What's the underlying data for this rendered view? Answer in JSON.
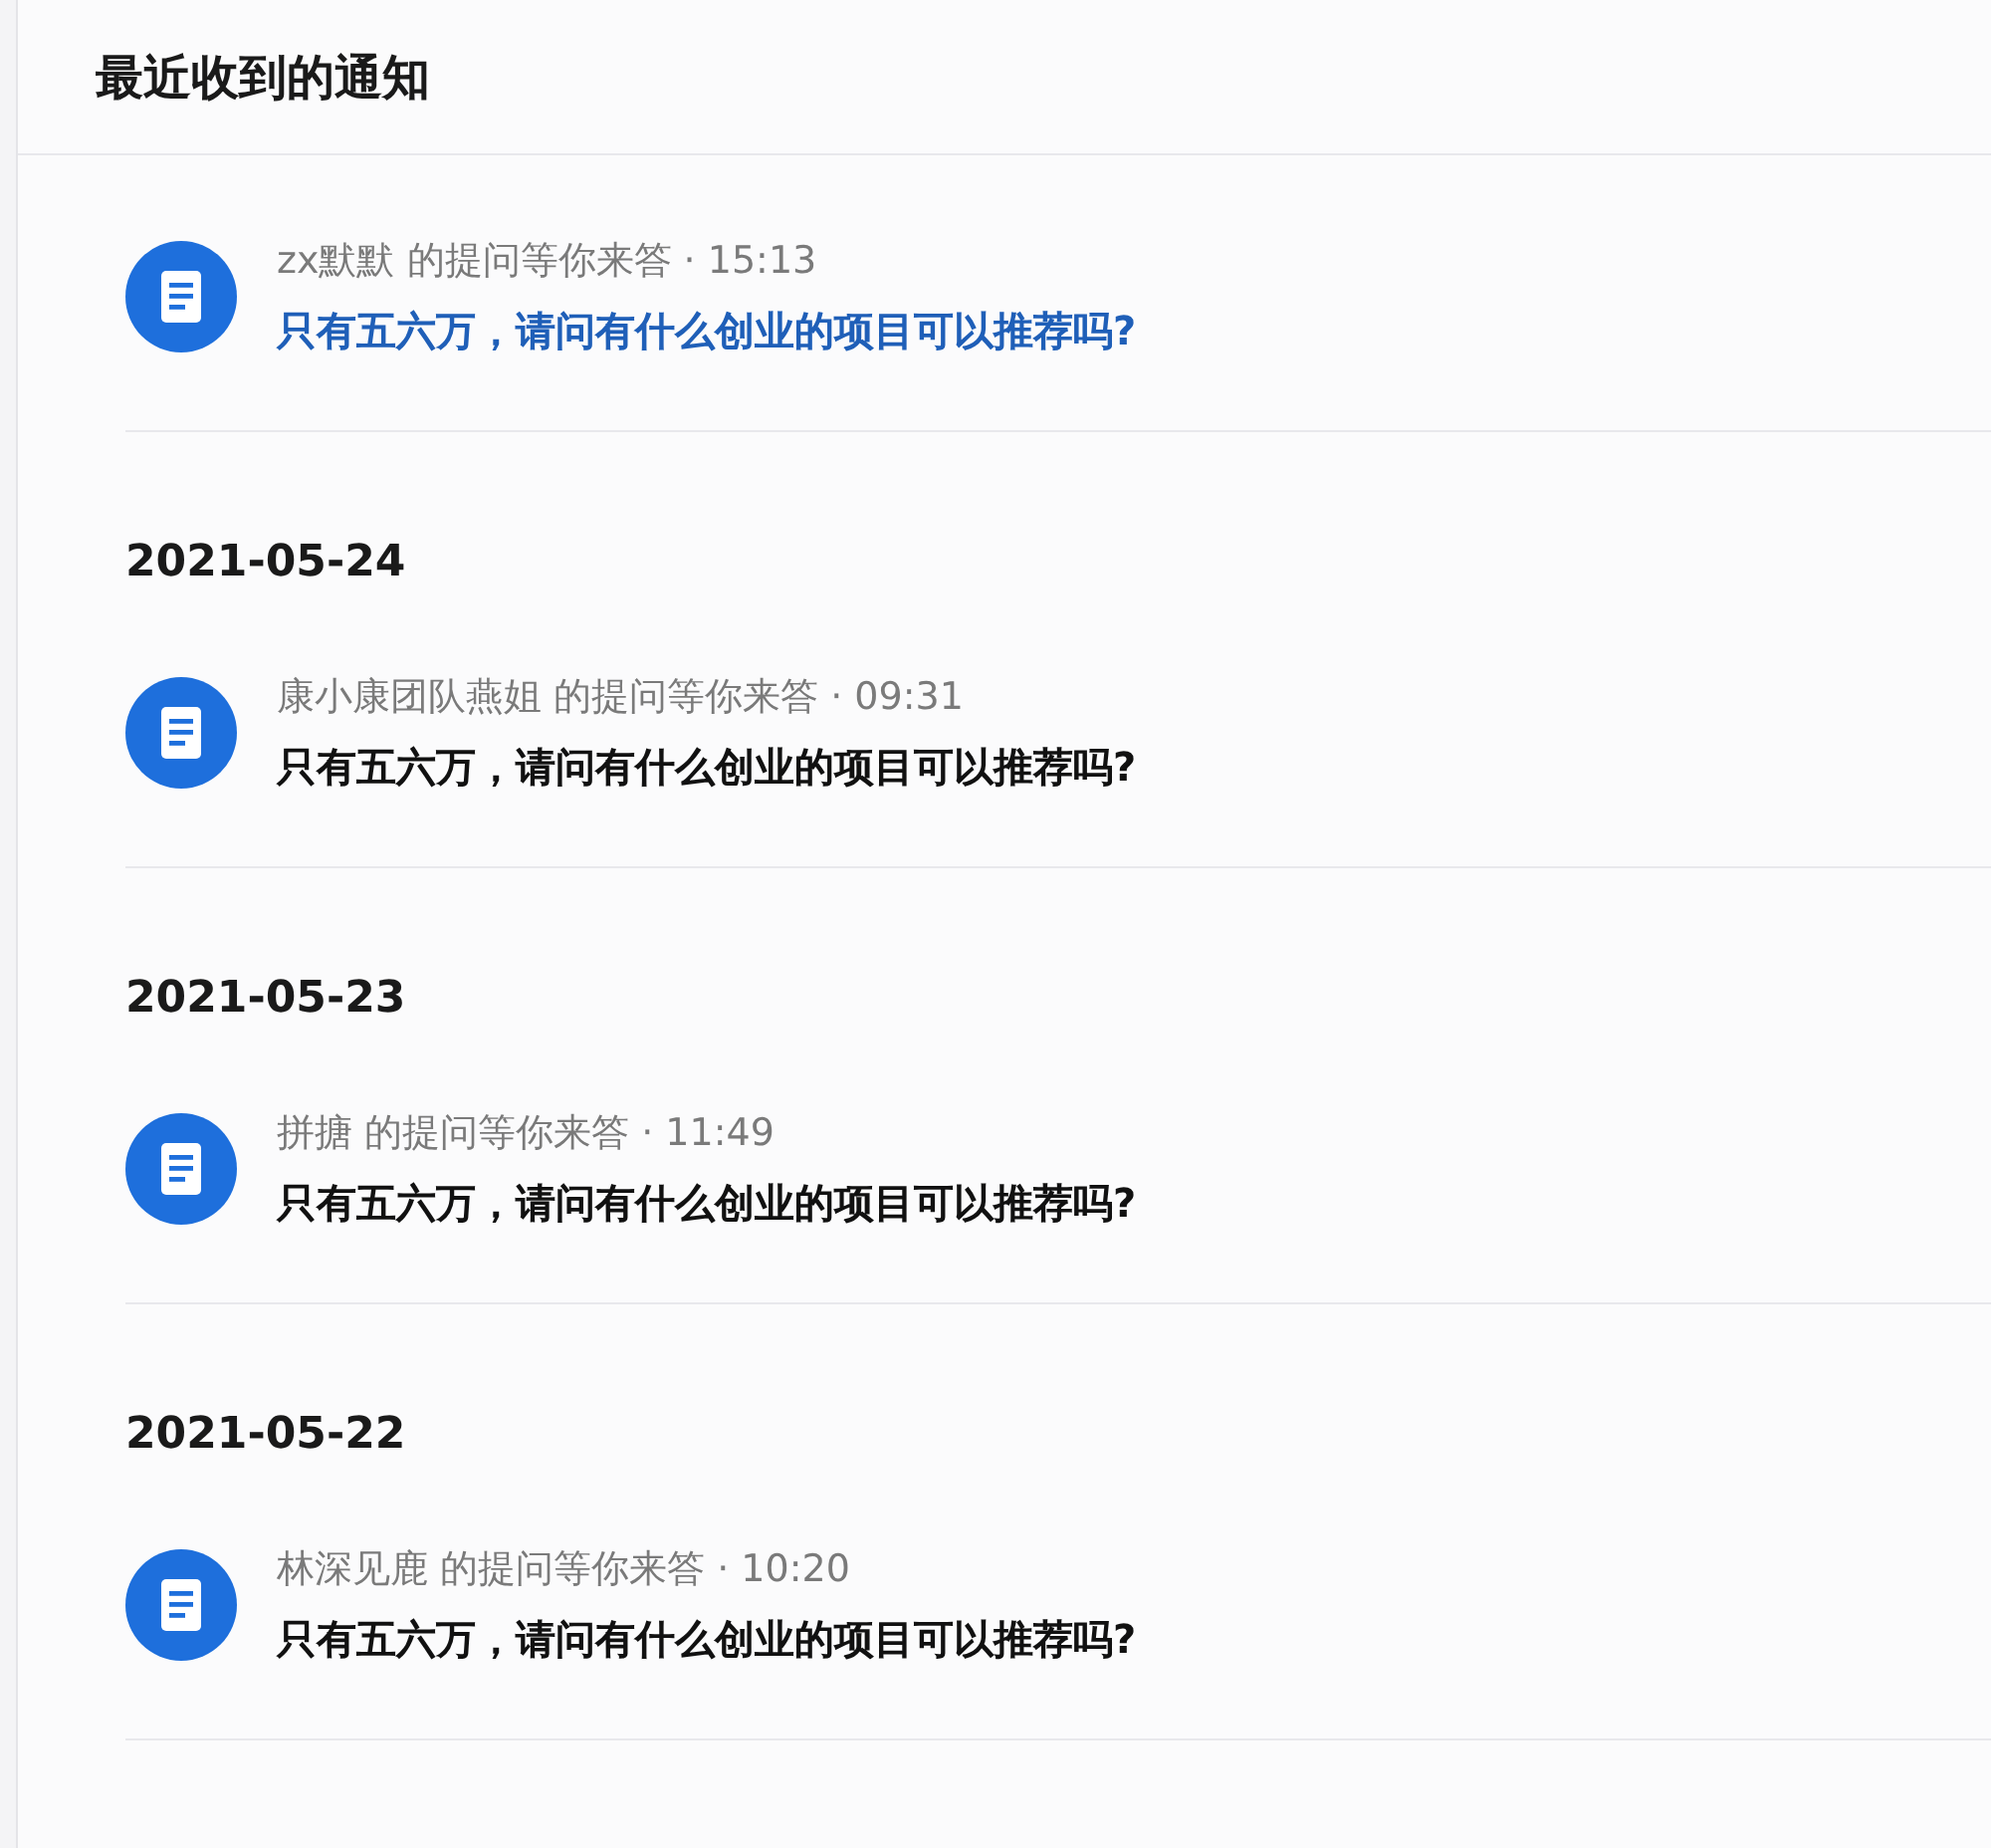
{
  "header": {
    "title": "最近收到的通知"
  },
  "groups": [
    {
      "items": [
        {
          "user": "zx默默",
          "action": "的提问等你来答",
          "time": "· 15:13",
          "question": "只有五六万，请问有什么创业的项目可以推荐吗?",
          "highlighted": true
        }
      ]
    },
    {
      "date": "2021-05-24",
      "items": [
        {
          "user": "康小康团队燕姐",
          "action": "的提问等你来答",
          "time": "· 09:31",
          "question": "只有五六万，请问有什么创业的项目可以推荐吗?",
          "highlighted": false
        }
      ]
    },
    {
      "date": "2021-05-23",
      "items": [
        {
          "user": "拼搪",
          "action": "的提问等你来答",
          "time": "· 11:49",
          "question": "只有五六万，请问有什么创业的项目可以推荐吗?",
          "highlighted": false
        }
      ]
    },
    {
      "date": "2021-05-22",
      "items": [
        {
          "user": "林深见鹿",
          "action": "的提问等你来答",
          "time": "· 10:20",
          "question": "只有五六万，请问有什么创业的项目可以推荐吗?",
          "highlighted": false
        }
      ]
    }
  ]
}
